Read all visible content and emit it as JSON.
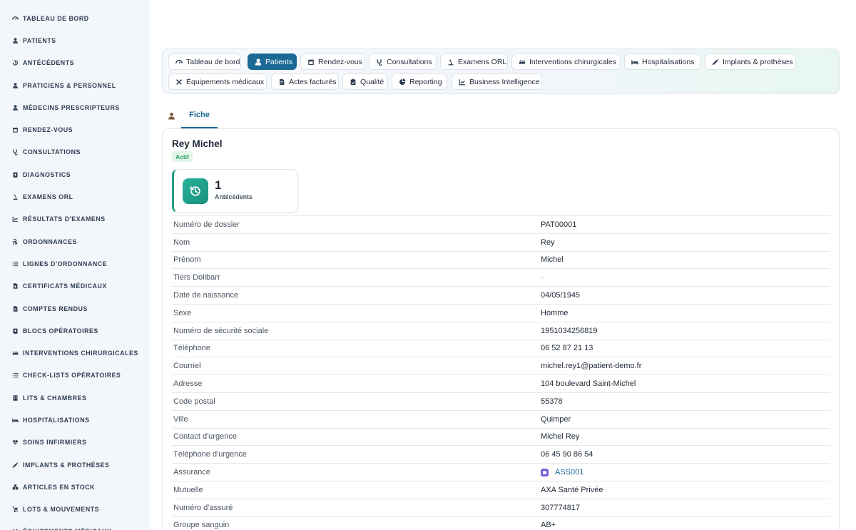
{
  "sidebar": {
    "items": [
      {
        "label": "Tableau de bord",
        "icon": "dashboard-icon"
      },
      {
        "label": "Patients",
        "icon": "user-icon"
      },
      {
        "label": "Antécédents",
        "icon": "history-icon"
      },
      {
        "label": "Praticiens & personnel",
        "icon": "user-md-icon"
      },
      {
        "label": "Médecins prescripteurs",
        "icon": "user-md-icon"
      },
      {
        "label": "Rendez-vous",
        "icon": "calendar-icon"
      },
      {
        "label": "Consultations",
        "icon": "stethoscope-icon"
      },
      {
        "label": "Diagnostics",
        "icon": "notes-medical-icon"
      },
      {
        "label": "Examens ORL",
        "icon": "microscope-icon"
      },
      {
        "label": "Résultats d'examens",
        "icon": "chart-line-icon"
      },
      {
        "label": "Ordonnances",
        "icon": "prescription-icon"
      },
      {
        "label": "Lignes d'ordonnance",
        "icon": "list-icon"
      },
      {
        "label": "Certificats médicaux",
        "icon": "file-medical-icon"
      },
      {
        "label": "Comptes rendus",
        "icon": "file-alt-icon"
      },
      {
        "label": "Blocs opératoires",
        "icon": "hospital-icon"
      },
      {
        "label": "Interventions chirurgicales",
        "icon": "procedures-icon"
      },
      {
        "label": "Check-lists opératoires",
        "icon": "checklist-icon"
      },
      {
        "label": "Lits & chambres",
        "icon": "building-icon"
      },
      {
        "label": "Hospitalisations",
        "icon": "bed-icon"
      },
      {
        "label": "Soins infirmiers",
        "icon": "heartbeat-icon"
      },
      {
        "label": "Implants & prothèses",
        "icon": "syringe-icon"
      },
      {
        "label": "Articles en stock",
        "icon": "boxes-icon"
      },
      {
        "label": "Lots & mouvements",
        "icon": "dolly-icon"
      },
      {
        "label": "Équipements médicaux",
        "icon": "tools-icon"
      }
    ]
  },
  "nav": {
    "pills": [
      {
        "label": "Tableau de bord",
        "icon": "dashboard-icon",
        "active": false
      },
      {
        "label": "Patients",
        "icon": "user-icon",
        "active": true
      },
      {
        "label": "Rendez-vous",
        "icon": "calendar-icon",
        "active": false
      },
      {
        "label": "Consultations",
        "icon": "stethoscope-icon",
        "active": false
      },
      {
        "label": "Examens ORL",
        "icon": "microscope-icon",
        "active": false
      },
      {
        "label": "Interventions chirurgicales",
        "icon": "procedures-icon",
        "active": false
      },
      {
        "label": "Hospitalisations",
        "icon": "bed-icon",
        "active": false
      },
      {
        "label": "Implants & prothèses",
        "icon": "syringe-icon",
        "active": false
      },
      {
        "label": "Équipements médicaux",
        "icon": "tools-icon",
        "active": false
      },
      {
        "label": "Actes facturés",
        "icon": "file-invoice-icon",
        "active": false
      },
      {
        "label": "Qualité",
        "icon": "clipboard-check-icon",
        "active": false
      },
      {
        "label": "Reporting",
        "icon": "chart-pie-icon",
        "active": false
      },
      {
        "label": "Business Intelligence",
        "icon": "chart-line-icon",
        "active": false
      }
    ]
  },
  "tabs": {
    "fiche": "Fiche"
  },
  "record": {
    "name": "Rey Michel",
    "status": "Actif",
    "stat_value": "1",
    "stat_label": "Antécédents"
  },
  "fields": [
    {
      "label": "Numéro de dossier",
      "value": "PAT00001"
    },
    {
      "label": "Nom",
      "value": "Rey"
    },
    {
      "label": "Prénom",
      "value": "Michel"
    },
    {
      "label": "Tiers Dolibarr",
      "value": "-"
    },
    {
      "label": "Date de naissance",
      "value": "04/05/1945"
    },
    {
      "label": "Sexe",
      "value": "Homme"
    },
    {
      "label": "Numéro de sécurité sociale",
      "value": "1951034256819"
    },
    {
      "label": "Téléphone",
      "value": "06 52 87 21 13"
    },
    {
      "label": "Courriel",
      "value": "michel.rey1@patient-demo.fr"
    },
    {
      "label": "Adresse",
      "value": "104 boulevard Saint-Michel"
    },
    {
      "label": "Code postal",
      "value": "55378"
    },
    {
      "label": "Ville",
      "value": "Quimper"
    },
    {
      "label": "Contact d'urgence",
      "value": "Michel Rey"
    },
    {
      "label": "Téléphone d'urgence",
      "value": "06 45 90 86 54"
    },
    {
      "label": "Assurance",
      "value": "ASS001"
    },
    {
      "label": "Mutuelle",
      "value": "AXA Santé Privée"
    },
    {
      "label": "Numéro d'assuré",
      "value": "307774817"
    },
    {
      "label": "Groupe sanguin",
      "value": "AB+"
    }
  ],
  "colors": {
    "accent": "#1b6a96",
    "stat_green": "#1f9c85",
    "badge_bg": "#e3f6ea",
    "badge_text": "#2f9a5e",
    "sidebar_bg": "#f3f6fb"
  }
}
